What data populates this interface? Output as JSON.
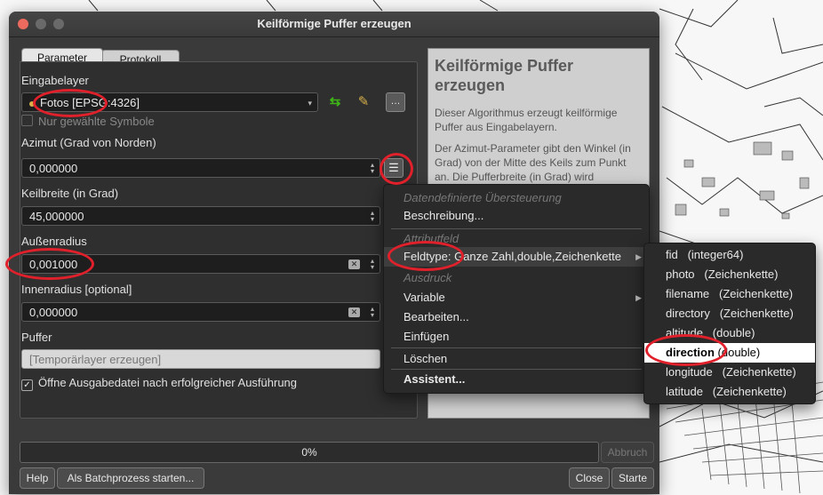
{
  "window": {
    "title": "Keilförmige Puffer erzeugen"
  },
  "tabs": {
    "parameter": "Parameter",
    "protokoll": "Protokoll"
  },
  "form": {
    "eingabelayer_label": "Eingabelayer",
    "eingabelayer_value": "Fotos [EPSG:4326]",
    "nur_gewaehlte": "Nur gewählte Symbole",
    "azimut_label": "Azimut (Grad von Norden)",
    "azimut_value": "0,000000",
    "keilbreite_label": "Keilbreite (in Grad)",
    "keilbreite_value": "45,000000",
    "aussenradius_label": "Außenradius",
    "aussenradius_value": "0,001000",
    "innenradius_label": "Innenradius [optional]",
    "innenradius_value": "0,000000",
    "puffer_label": "Puffer",
    "puffer_placeholder": "[Temporärlayer erzeugen]",
    "oeffne_label": "Öffne Ausgabedatei nach erfolgreicher Ausführung"
  },
  "help": {
    "title": "Keilförmige Puffer erzeugen",
    "p1": "Dieser Algorithmus erzeugt keilförmige Puffer aus Eingabelayern.",
    "p2": "Der Azimut-Parameter gibt den Winkel (in Grad) von der Mitte des Keils zum Punkt an. Die Pufferbreite (in Grad) wird"
  },
  "progress": {
    "value": 0,
    "label": "0%"
  },
  "buttons": {
    "abbruch": "Abbruch",
    "help": "Help",
    "batch": "Als Batchprozess starten...",
    "close": "Close",
    "starte": "Starte"
  },
  "context_menu": {
    "header": "Datendefinierte Übersteuerung",
    "beschreibung": "Beschreibung...",
    "attributfeld": "Attributfeld",
    "feldtype": "Feldtype: Ganze Zahl,double,Zeichenkette",
    "ausdruck": "Ausdruck",
    "variable": "Variable",
    "bearbeiten": "Bearbeiten...",
    "einfuegen": "Einfügen",
    "loeschen": "Löschen",
    "assistent": "Assistent..."
  },
  "submenu": [
    {
      "name": "fid",
      "type": "(integer64)"
    },
    {
      "name": "photo",
      "type": "(Zeichenkette)"
    },
    {
      "name": "filename",
      "type": "(Zeichenkette)"
    },
    {
      "name": "directory",
      "type": "(Zeichenkette)"
    },
    {
      "name": "altitude",
      "type": "(double)"
    },
    {
      "name": "direction",
      "type": "(double)"
    },
    {
      "name": "longitude",
      "type": "(Zeichenkette)"
    },
    {
      "name": "latitude",
      "type": "(Zeichenkette)"
    }
  ],
  "colors": {
    "annotation": "#e0202a",
    "accent_icon": "#3fb618"
  }
}
